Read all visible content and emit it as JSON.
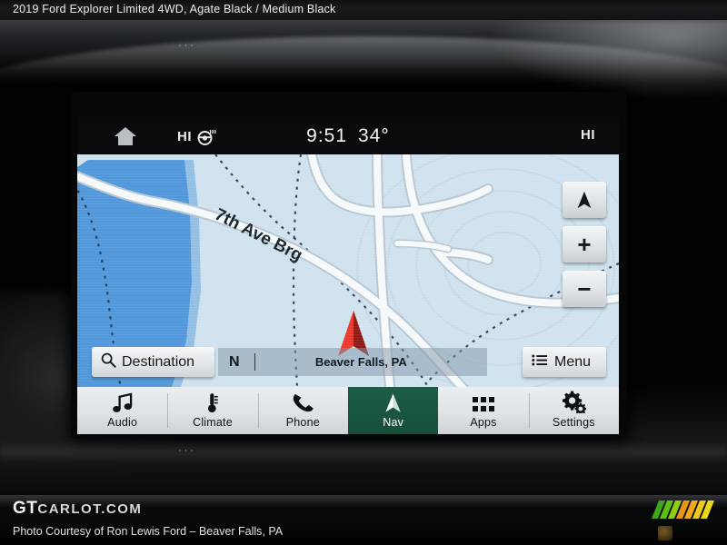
{
  "listing": {
    "title": "2019 Ford Explorer Limited 4WD,  Agate Black / Medium Black"
  },
  "infotainment": {
    "status_bar": {
      "home_icon": "home-icon",
      "left_climate_level": "HI",
      "heated_steering_icon": "heated-steering-wheel-icon",
      "clock": "9:51",
      "temperature": "34°",
      "right_climate_level": "HI"
    },
    "map": {
      "road_label": "7th Ave Brg",
      "vehicle_marker": "vehicle-position-arrow-icon",
      "water_color": "#4a93d9",
      "land_color": "#cfe2ee",
      "road_color": "#f4f7f9",
      "buttons": [
        {
          "name": "map-orientation-button",
          "icon": "navigation-arrow-icon",
          "label": ""
        },
        {
          "name": "map-zoom-in-button",
          "icon": "plus-icon",
          "label": "+"
        },
        {
          "name": "map-zoom-out-button",
          "icon": "minus-icon",
          "label": "−"
        }
      ]
    },
    "controls": {
      "destination_label": "Destination",
      "destination_icon": "search-icon",
      "compass_heading": "N",
      "current_location": "Beaver Falls, PA",
      "menu_label": "Menu",
      "menu_icon": "list-icon"
    },
    "tabs": [
      {
        "label": "Audio",
        "icon": "music-note-icon",
        "active": false
      },
      {
        "label": "Climate",
        "icon": "thermometer-icon",
        "active": false
      },
      {
        "label": "Phone",
        "icon": "phone-handset-icon",
        "active": false
      },
      {
        "label": "Nav",
        "icon": "navigation-arrow-icon",
        "active": true
      },
      {
        "label": "Apps",
        "icon": "grid-apps-icon",
        "active": false
      },
      {
        "label": "Settings",
        "icon": "gears-icon",
        "active": false
      }
    ],
    "active_tab_color": "#1d5c45"
  },
  "footer": {
    "wordmark_bold": "GT",
    "wordmark_rest": "CARLOT.COM",
    "credit": "Photo Courtesy of Ron Lewis Ford – Beaver Falls, PA",
    "stripe_colors": [
      "#3ea618",
      "#5fbf17",
      "#8fcc14",
      "#e8931a",
      "#f0a81c",
      "#efc81d",
      "#ead81b"
    ]
  },
  "dashboard": {
    "vent_dots": "···"
  }
}
